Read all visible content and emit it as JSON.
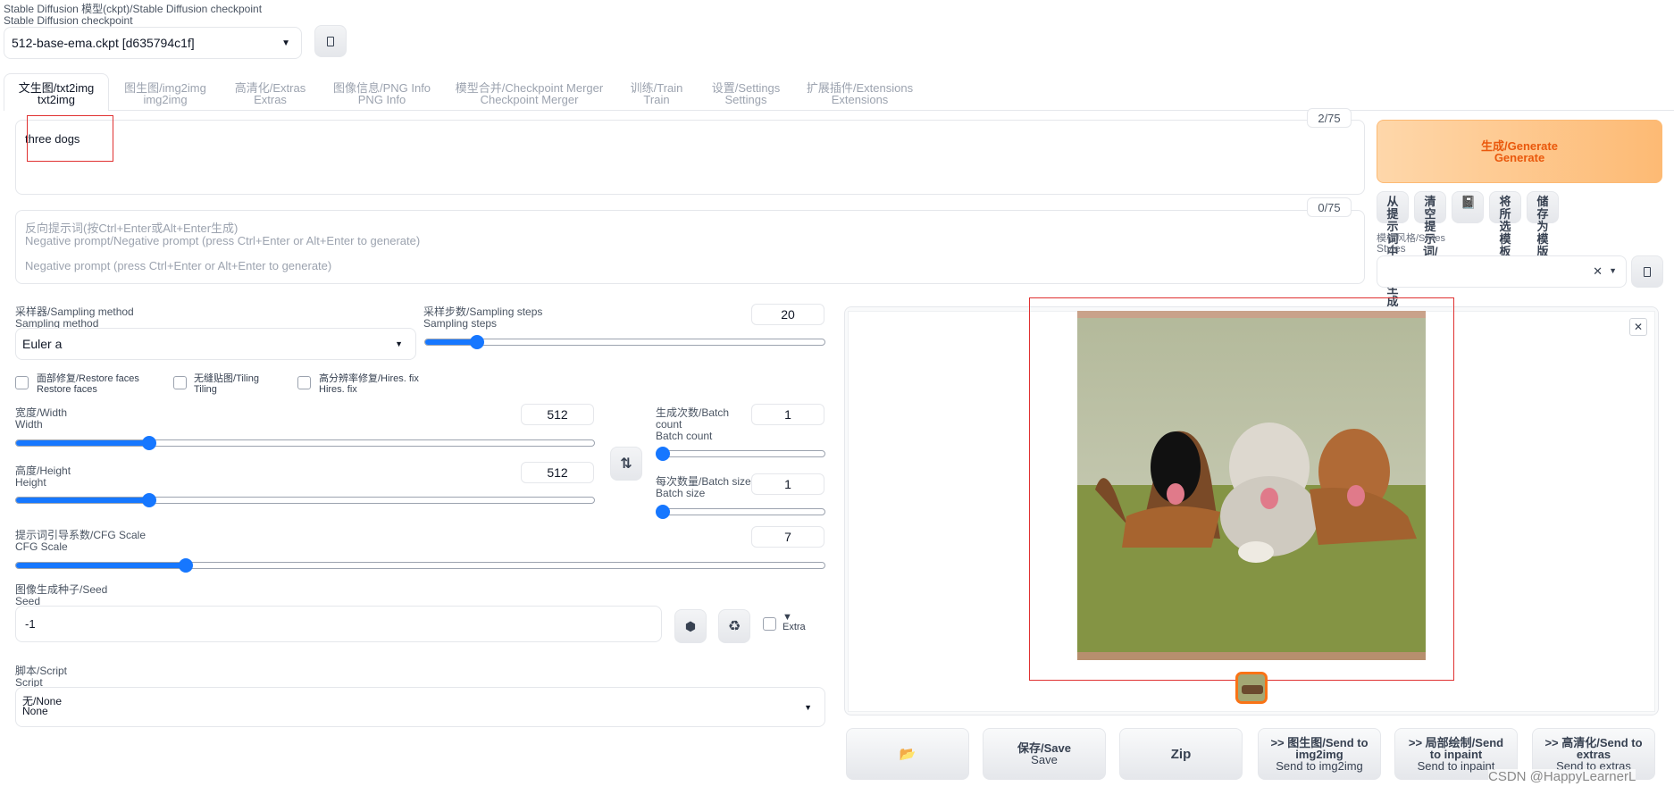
{
  "checkpoint": {
    "label_cn": "Stable Diffusion 模型(ckpt)/Stable Diffusion checkpoint",
    "label_en": "Stable Diffusion checkpoint",
    "value": "512-base-ema.ckpt [d635794c1f]"
  },
  "tabs": [
    {
      "cn": "文生图/txt2img",
      "en": "txt2img",
      "active": true
    },
    {
      "cn": "图生图/img2img",
      "en": "img2img"
    },
    {
      "cn": "高清化/Extras",
      "en": "Extras"
    },
    {
      "cn": "图像信息/PNG Info",
      "en": "PNG Info"
    },
    {
      "cn": "模型合并/Checkpoint Merger",
      "en": "Checkpoint Merger"
    },
    {
      "cn": "训练/Train",
      "en": "Train"
    },
    {
      "cn": "设置/Settings",
      "en": "Settings"
    },
    {
      "cn": "扩展插件/Extensions",
      "en": "Extensions"
    }
  ],
  "prompt": {
    "value": "three dogs",
    "counter": "2/75"
  },
  "negative": {
    "counter": "0/75",
    "placeholder_cn": "反向提示词(按Ctrl+Enter或Alt+Enter生成)",
    "placeholder_en1": "Negative prompt/Negative prompt (press Ctrl+Enter or Alt+Enter to generate)",
    "placeholder_en2": "Negative prompt (press Ctrl+Enter or Alt+Enter to generate)"
  },
  "generate": {
    "cn": "生成/Generate",
    "en": "Generate"
  },
  "tools": [
    "从提示词中读取生成",
    "清空提示词/",
    "📓",
    "将所选模板应用",
    "储存为模版"
  ],
  "styles": {
    "label_cn": "模板风格/Styles",
    "label_en": "Styles"
  },
  "sampler": {
    "label_cn": "采样器/Sampling method",
    "label_en": "Sampling method",
    "value": "Euler a"
  },
  "steps": {
    "label_cn": "采样步数/Sampling steps",
    "label_en": "Sampling steps",
    "value": "20",
    "fraction": 0.13
  },
  "checks": {
    "restore_cn": "面部修复/Restore faces",
    "restore_en": "Restore faces",
    "tiling_cn": "无缝贴图/Tiling",
    "tiling_en": "Tiling",
    "hires_cn": "高分辨率修复/Hires. fix",
    "hires_en": "Hires. fix"
  },
  "width": {
    "label_cn": "宽度/Width",
    "label_en": "Width",
    "value": "512",
    "fraction": 0.23
  },
  "height": {
    "label_cn": "高度/Height",
    "label_en": "Height",
    "value": "512",
    "fraction": 0.23
  },
  "batch_count": {
    "label_cn": "生成次数/Batch",
    "label_cn2": "count",
    "label_en": "Batch count",
    "value": "1",
    "fraction": 0.0
  },
  "batch_size": {
    "label_cn": "每次数量/Batch size",
    "label_en": "Batch size",
    "value": "1",
    "fraction": 0.0
  },
  "cfg": {
    "label_cn": "提示词引导系数/CFG Scale",
    "label_en": "CFG Scale",
    "value": "7",
    "fraction": 0.21
  },
  "seed": {
    "label_cn": "图像生成种子/Seed",
    "label_en": "Seed",
    "value": "-1",
    "extra": "Extra",
    "extra_arrow": "▼"
  },
  "script": {
    "label_cn": "脚本/Script",
    "label_en": "Script",
    "value_cn": "无/None",
    "value_en": "None"
  },
  "output_buttons": [
    {
      "main": "📂",
      "sub": ""
    },
    {
      "main": "保存/Save",
      "sub": "Save"
    },
    {
      "main": "Zip",
      "sub": ""
    },
    {
      "main": ">> 图生图/Send to img2img",
      "sub": "Send to img2img"
    },
    {
      "main": ">> 局部绘制/Send to inpaint",
      "sub": "Send to inpaint"
    },
    {
      "main": ">> 高清化/Send to extras",
      "sub": "Send to extras"
    }
  ],
  "watermark": "CSDN @HappyLearnerL",
  "colors": {
    "accent": "#1677ff",
    "generate_bg": "#fdba74",
    "generate_text": "#ea580c",
    "annotation": "#e03131"
  }
}
